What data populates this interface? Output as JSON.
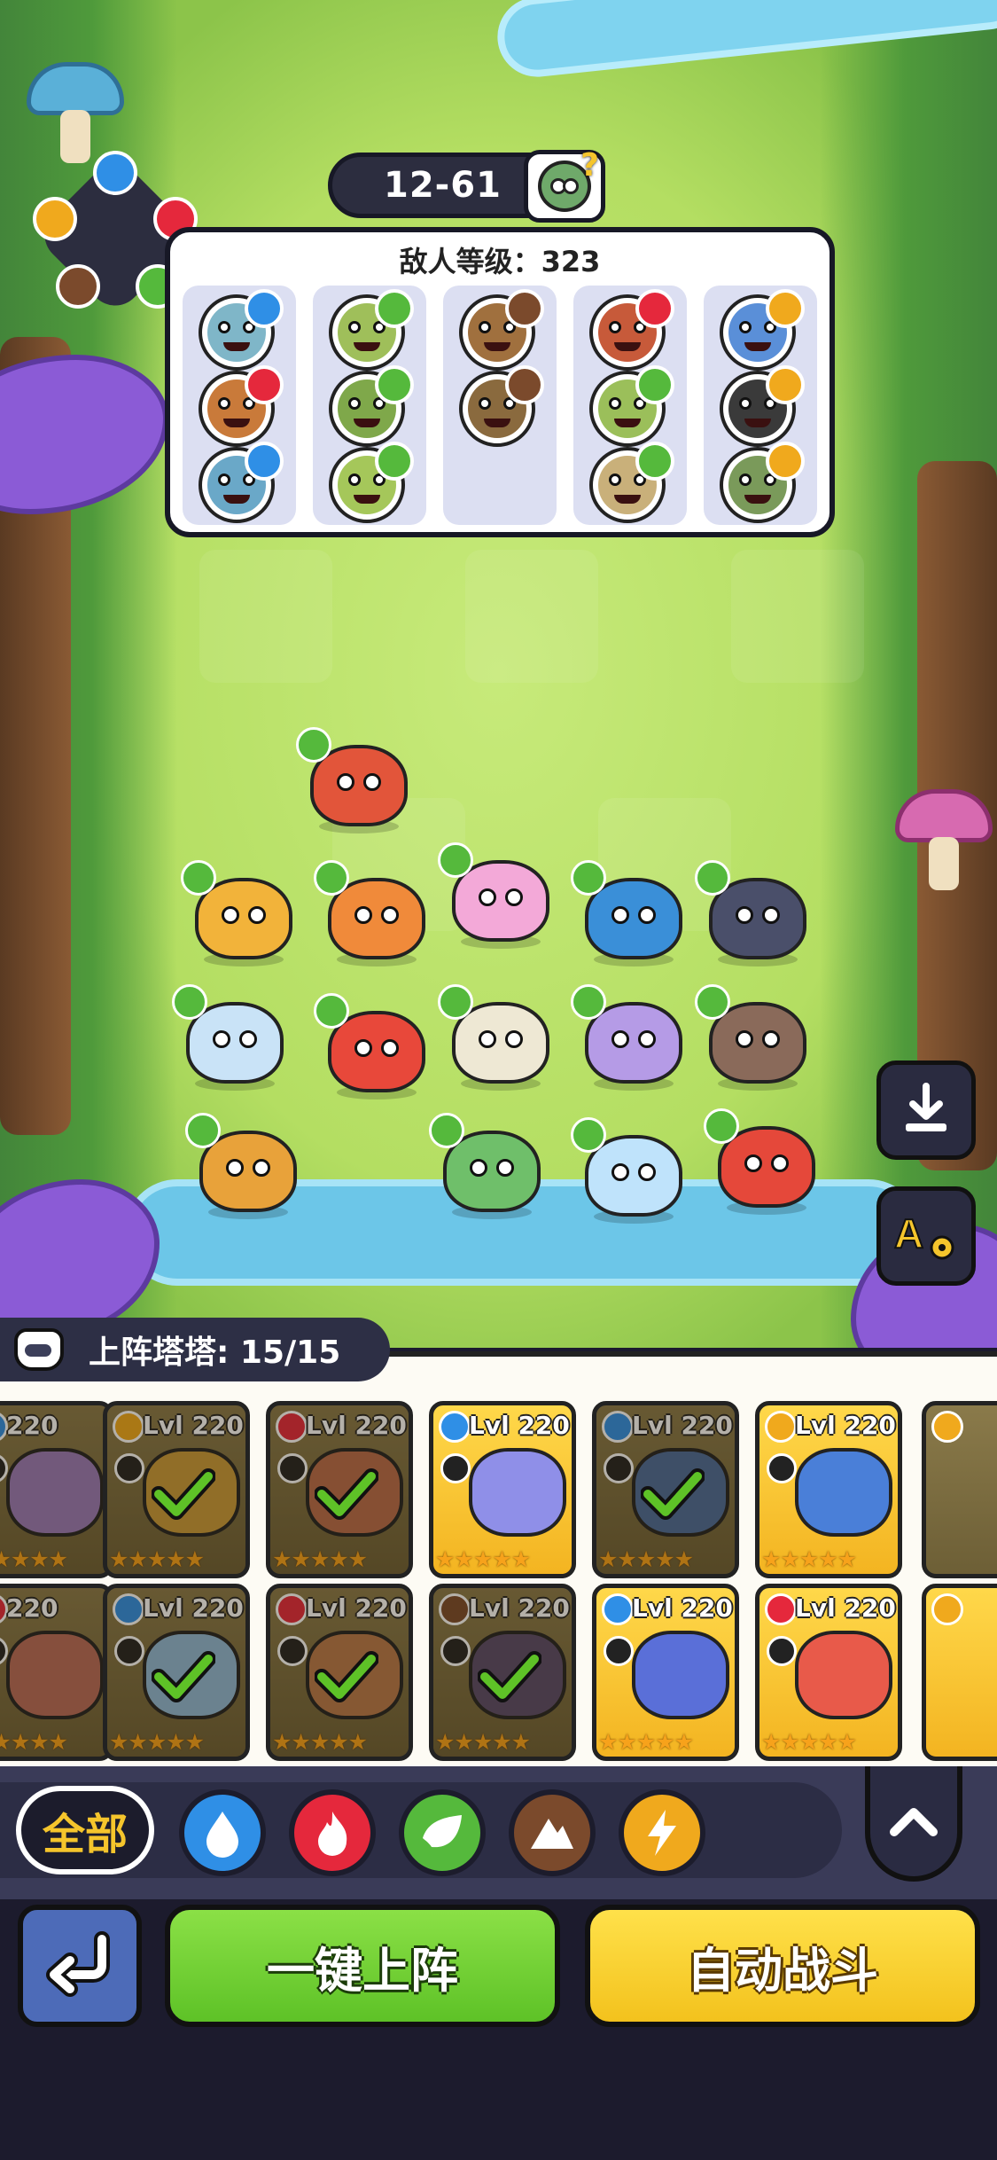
{
  "stage": {
    "label": "12-61",
    "icon": "zombie-question-icon"
  },
  "enemy_panel": {
    "title": "敌人等级：323",
    "columns": [
      {
        "enemies": [
          {
            "element": "water",
            "color": "#7fb6c8"
          },
          {
            "element": "fire",
            "color": "#c97a3a"
          },
          {
            "element": "water",
            "color": "#6aa8c8"
          }
        ]
      },
      {
        "enemies": [
          {
            "element": "leaf",
            "color": "#9fbf5a"
          },
          {
            "element": "leaf",
            "color": "#7fa84a"
          },
          {
            "element": "leaf",
            "color": "#a5c75a"
          }
        ]
      },
      {
        "enemies": [
          {
            "element": "earth",
            "color": "#a0703e"
          },
          {
            "element": "earth",
            "color": "#8a6a3e"
          }
        ]
      },
      {
        "enemies": [
          {
            "element": "fire",
            "color": "#c75a3a"
          },
          {
            "element": "leaf",
            "color": "#9bbf5a"
          },
          {
            "element": "leaf",
            "color": "#c9b07a"
          }
        ]
      },
      {
        "enemies": [
          {
            "element": "bolt",
            "color": "#5a8fd8"
          },
          {
            "element": "bolt",
            "color": "#3a3a3a"
          },
          {
            "element": "bolt",
            "color": "#7a9a5a"
          }
        ]
      }
    ]
  },
  "element_wheel": [
    "water-icon",
    "fire-icon",
    "leaf-icon",
    "earth-icon",
    "bolt-icon"
  ],
  "heroes": [
    {
      "name": "fire-dog-hero",
      "color": "#e2553a"
    },
    {
      "name": "lion-hero",
      "color": "#f2b33a"
    },
    {
      "name": "fire-bird-hero",
      "color": "#f08a3a"
    },
    {
      "name": "flower-fairy-hero",
      "color": "#f3a9d8"
    },
    {
      "name": "water-seal-hero",
      "color": "#3a8fd8"
    },
    {
      "name": "rock-dino-hero",
      "color": "#4a4f6a"
    },
    {
      "name": "ice-bear-hero",
      "color": "#c9e3f7"
    },
    {
      "name": "fox-hero",
      "color": "#e8483a"
    },
    {
      "name": "seed-hero",
      "color": "#eee8d4"
    },
    {
      "name": "purple-cat-hero",
      "color": "#b59be6"
    },
    {
      "name": "monkey-hero",
      "color": "#8a6a5a"
    },
    {
      "name": "deer-hero",
      "color": "#e8a23a"
    },
    {
      "name": "plant-frog-hero",
      "color": "#6fbf6a"
    },
    {
      "name": "water-spirit-hero",
      "color": "#bfe3fb"
    },
    {
      "name": "fire-dragon-hero",
      "color": "#e5483a"
    }
  ],
  "side_buttons": {
    "download": "download-icon",
    "auto_settings": "auto-settings-icon"
  },
  "lineup": {
    "label": "上阵塔塔: 15/15"
  },
  "cards_row1": [
    {
      "lvl": "220",
      "element": "water",
      "state": "dim",
      "partial": true,
      "portrait": "#9a7ab8"
    },
    {
      "lvl": "Lvl 220",
      "element": "bolt",
      "state": "dim",
      "checked": true,
      "portrait": "#c99a3a"
    },
    {
      "lvl": "Lvl 220",
      "element": "fire",
      "state": "dim",
      "checked": true,
      "portrait": "#b86a4a"
    },
    {
      "lvl": "Lvl 220",
      "element": "water",
      "state": "gold",
      "checked": false,
      "portrait": "#8f8fe8"
    },
    {
      "lvl": "Lvl 220",
      "element": "water",
      "state": "dim",
      "checked": true,
      "portrait": "#4a6a9a"
    },
    {
      "lvl": "Lvl 220",
      "element": "bolt",
      "state": "gold",
      "checked": false,
      "portrait": "#4a7fd8"
    }
  ],
  "cards_row2": [
    {
      "lvl": "220",
      "element": "fire",
      "state": "dim",
      "partial": true,
      "portrait": "#b86a5a"
    },
    {
      "lvl": "Lvl 220",
      "element": "water",
      "state": "dim",
      "checked": true,
      "portrait": "#8fb8d8"
    },
    {
      "lvl": "Lvl 220",
      "element": "fire",
      "state": "dim",
      "checked": true,
      "portrait": "#b8784a"
    },
    {
      "lvl": "Lvl 220",
      "element": "earth",
      "state": "dim",
      "checked": true,
      "portrait": "#5a4a6a"
    },
    {
      "lvl": "Lvl 220",
      "element": "water",
      "state": "gold",
      "checked": false,
      "portrait": "#5a6fd8"
    },
    {
      "lvl": "Lvl 220",
      "element": "fire",
      "state": "gold",
      "checked": false,
      "portrait": "#e85a4a"
    }
  ],
  "stars": "★★★★★",
  "filter": {
    "all_label": "全部",
    "elements": [
      "water-filter",
      "fire-filter",
      "leaf-filter",
      "earth-filter",
      "bolt-filter"
    ]
  },
  "actions": {
    "deploy_label": "一键上阵",
    "auto_battle_label": "自动战斗"
  },
  "colors": {
    "water": "#2f8fe6",
    "fire": "#e5283c",
    "leaf": "#55b93c",
    "earth": "#7b4a2c",
    "bolt": "#f0a91d",
    "gold_card": "#f3b421",
    "deploy": "#5ec227",
    "auto": "#f3c21d"
  }
}
